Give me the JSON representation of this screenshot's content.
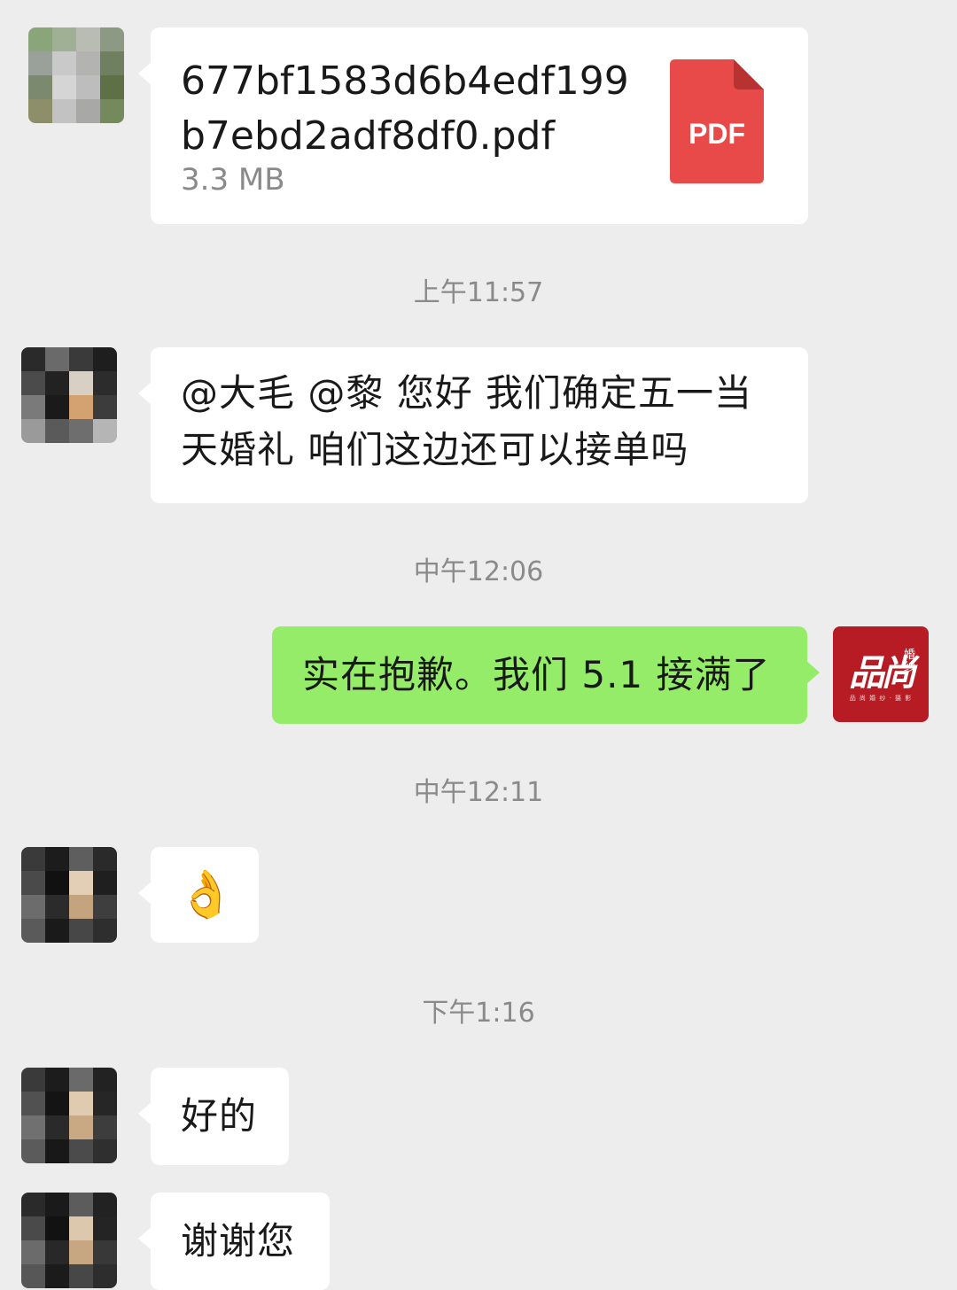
{
  "messages": {
    "file": {
      "name": "677bf1583d6b4edf199b7ebd2adf8df0.pdf",
      "size": "3.3 MB",
      "icon_label": "PDF",
      "icon_color": "#e84a4a"
    },
    "time1": "上午11:57",
    "msg1": "@大毛  @黎   您好 我们确定五一当天婚礼 咱们这边还可以接单吗",
    "time2": "中午12:06",
    "msg2": "实在抱歉。我们 5.1 接满了",
    "time3": "中午12:11",
    "msg3_emoji": "👌",
    "time4": "下午1:16",
    "msg4": "好的",
    "msg5": "谢谢您"
  },
  "self_avatar": {
    "logo_text": "品尚",
    "logo_badge": "婚纱",
    "logo_sub": "品 尚 婚 纱 · 摄 影",
    "color": "#b71c25"
  },
  "colors": {
    "background": "#ededed",
    "incoming_bubble": "#ffffff",
    "outgoing_bubble": "#95ec69",
    "timestamp": "#8a8a8a"
  }
}
